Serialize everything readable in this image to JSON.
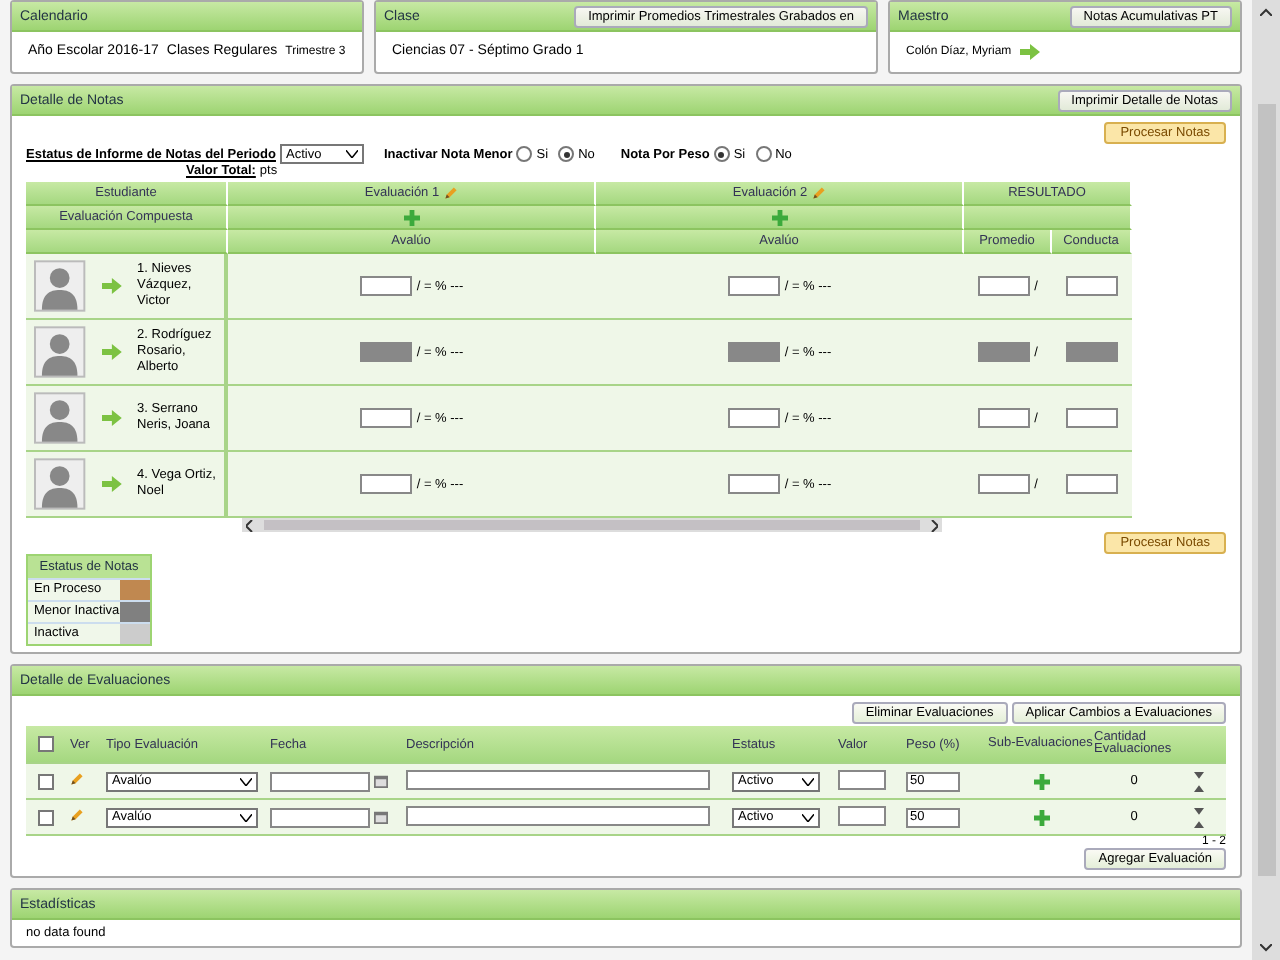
{
  "calendar": {
    "heading": "Calendario",
    "year": "Año Escolar 2016-17",
    "type": "Clases Regulares",
    "term": "Trimestre 3"
  },
  "class": {
    "heading": "Clase",
    "button": "Imprimir Promedios Trimestrales Grabados en",
    "name": "Ciencias 07 -  Séptimo Grado  1"
  },
  "teacher": {
    "heading": "Maestro",
    "button": "Notas Acumulativas PT",
    "name": "Colón Díaz, Myriam"
  },
  "notes": {
    "title": "Detalle de Notas",
    "print_button": "Imprimir Detalle de Notas",
    "process_button": "Procesar Notas",
    "status_label": "Estatus de Informe de Notas del Periodo",
    "status_value": "Activo",
    "inactivate_label": "Inactivar Nota Menor",
    "inactivate_options": [
      {
        "label": "Si",
        "selected": false
      },
      {
        "label": "No",
        "selected": true
      }
    ],
    "weight_label": "Nota Por Peso",
    "weight_options": [
      {
        "label": "Si",
        "selected": true
      },
      {
        "label": "No",
        "selected": false
      }
    ],
    "total_label": "Valor Total:",
    "total_unit": "pts",
    "header": {
      "student": "Estudiante",
      "evaluations": [
        "Evaluación 1",
        "Evaluación 2"
      ],
      "result": "RESULTADO",
      "composite": "Evaluación Compuesta",
      "eval_sub": [
        "Avalúo",
        "Avalúo"
      ],
      "average": "Promedio",
      "conduct": "Conducta"
    },
    "score_suffix": "/ = % ---",
    "average_suffix": "/",
    "rows": [
      {
        "name": "1. Nieves Vázquez, Victor",
        "disabled": false
      },
      {
        "name": "2. Rodríguez Rosario, Alberto",
        "disabled": true
      },
      {
        "name": "3. Serrano Neris, Joana",
        "disabled": false
      },
      {
        "name": "4. Vega Ortiz, Noel",
        "disabled": false
      }
    ],
    "process_button_bottom": "Procesar Notas",
    "legend": {
      "title": "Estatus de Notas",
      "items": [
        {
          "label": "En Proceso",
          "color": "#c08850"
        },
        {
          "label": "Menor Inactiva",
          "color": "#808080"
        },
        {
          "label": "Inactiva",
          "color": "#cccccc"
        }
      ]
    }
  },
  "evaluations": {
    "title": "Detalle de Evaluaciones",
    "buttons": [
      "Eliminar Evaluaciones",
      "Aplicar Cambios a Evaluaciones"
    ],
    "columns": {
      "view": "Ver",
      "type": "Tipo Evaluación",
      "date": "Fecha",
      "description": "Descripción",
      "status": "Estatus",
      "value": "Valor",
      "weight": "Peso (%)",
      "sub": "Sub-Evaluaciones",
      "count": "Cantidad Evaluaciones"
    },
    "rows": [
      {
        "checked": false,
        "type": "Avalúo",
        "status": "Activo",
        "weight": "50",
        "count": "0"
      },
      {
        "checked": false,
        "type": "Avalúo",
        "status": "Activo",
        "weight": "50",
        "count": "0"
      }
    ],
    "select_all_checked": false,
    "pager": "1 - 2",
    "add_button": "Agregar Evaluación"
  },
  "stats": {
    "title": "Estadísticas",
    "message": "no data found"
  }
}
